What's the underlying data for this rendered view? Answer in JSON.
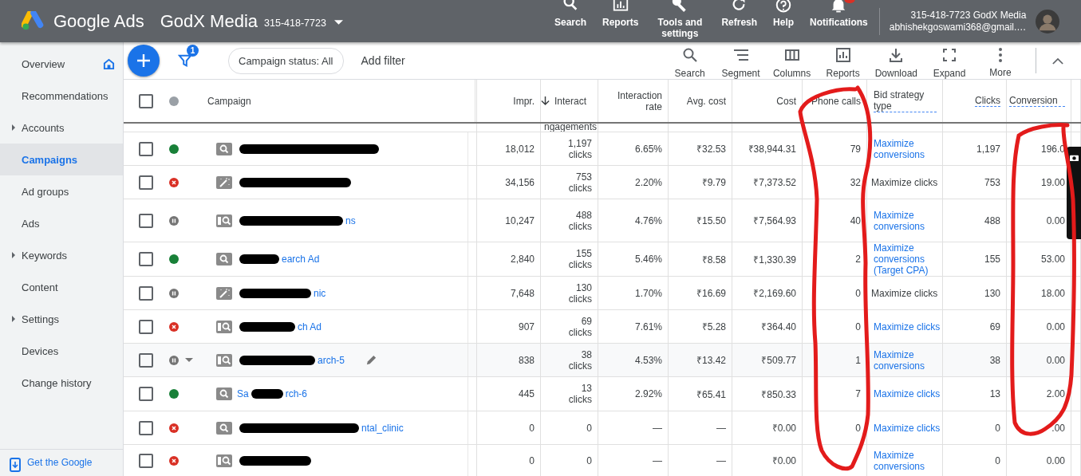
{
  "top_bar": {
    "product": "Google Ads",
    "account_name": "GodX Media",
    "account_id": "315-418-7723",
    "nav": [
      {
        "label": "Search",
        "kind": "search",
        "badge": false
      },
      {
        "label": "Reports",
        "kind": "reports",
        "badge": false
      },
      {
        "label": "Tools and settings",
        "kind": "tools",
        "badge": false
      },
      {
        "label": "Refresh",
        "kind": "refresh",
        "badge": false
      },
      {
        "label": "Help",
        "kind": "help",
        "badge": false
      },
      {
        "label": "Notifications",
        "kind": "notifications",
        "badge": true
      }
    ],
    "user": {
      "account": "315-418-7723 GodX Media",
      "email": "abhishekgoswami368@gmail.…"
    }
  },
  "sidebar": {
    "items": [
      {
        "label": "Overview",
        "kind": "home",
        "selected": false
      },
      {
        "label": "Recommendations",
        "kind": "plain",
        "selected": false
      },
      {
        "label": "Accounts",
        "kind": "expandable",
        "selected": false
      },
      {
        "label": "Campaigns",
        "kind": "plain",
        "selected": true
      },
      {
        "label": "Ad groups",
        "kind": "plain",
        "selected": false
      },
      {
        "label": "Ads",
        "kind": "plain",
        "selected": false
      },
      {
        "label": "Keywords",
        "kind": "expandable",
        "selected": false
      },
      {
        "label": "Content",
        "kind": "plain",
        "selected": false
      },
      {
        "label": "Settings",
        "kind": "expandable",
        "selected": false
      },
      {
        "label": "Devices",
        "kind": "plain",
        "selected": false
      },
      {
        "label": "Change history",
        "kind": "plain",
        "selected": false
      }
    ],
    "footer": "Get the Google"
  },
  "toolbar": {
    "filter_count": "1",
    "filter_chip": "Campaign status: All",
    "add_filter": "Add filter",
    "tools": [
      {
        "label": "Search",
        "kind": "search"
      },
      {
        "label": "Segment",
        "kind": "segment"
      },
      {
        "label": "Columns",
        "kind": "columns"
      },
      {
        "label": "Reports",
        "kind": "reports"
      },
      {
        "label": "Download",
        "kind": "download"
      },
      {
        "label": "Expand",
        "kind": "expand"
      },
      {
        "label": "More",
        "kind": "more"
      }
    ]
  },
  "table": {
    "header_checked": false,
    "columns": [
      {
        "label": "Campaign",
        "sorted": false,
        "underlined": false
      },
      {
        "label": "Impr.",
        "sorted": false,
        "underlined": false
      },
      {
        "label": "Interact",
        "sorted": true,
        "underlined": false
      },
      {
        "label": "Interaction rate",
        "sorted": false,
        "underlined": false
      },
      {
        "label": "Avg. cost",
        "sorted": false,
        "underlined": false
      },
      {
        "label": "Cost",
        "sorted": false,
        "underlined": false
      },
      {
        "label": "Phone calls",
        "sorted": false,
        "underlined": false
      },
      {
        "label": "Bid strategy type",
        "sorted": false,
        "underlined": true
      },
      {
        "label": "Clicks",
        "sorted": false,
        "underlined": true
      },
      {
        "label": "Conversion",
        "sorted": false,
        "underlined": true
      }
    ],
    "subheader": "ngagements",
    "rows": [
      {
        "checked": false,
        "hovered": false,
        "status": {
          "kind": "enabled"
        },
        "campaign_type": {
          "kind": "search"
        },
        "name": [
          {
            "kind": "redaction"
          }
        ],
        "impr": "18,012",
        "interactions": "1,197",
        "unit": "clicks",
        "rate": "6.65%",
        "avg_cost": "₹32.53",
        "cost": "₹38,944.31",
        "phone_calls": "79",
        "bid": {
          "text": "Maximize conversions",
          "link": true
        },
        "clicks": "1,197",
        "conversions": "196.0"
      },
      {
        "checked": false,
        "hovered": false,
        "status": {
          "kind": "removed"
        },
        "campaign_type": {
          "kind": "smart"
        },
        "name": [
          {
            "kind": "redaction"
          }
        ],
        "impr": "34,156",
        "interactions": "753",
        "unit": "clicks",
        "rate": "2.20%",
        "avg_cost": "₹9.79",
        "cost": "₹7,373.52",
        "phone_calls": "32",
        "bid": {
          "text": "Maximize clicks",
          "link": false
        },
        "clicks": "753",
        "conversions": "19.00"
      },
      {
        "checked": false,
        "hovered": false,
        "status": {
          "kind": "paused"
        },
        "campaign_type": {
          "kind": "page-search"
        },
        "name": [
          {
            "kind": "redaction"
          },
          {
            "kind": "text",
            "text": "ns"
          }
        ],
        "impr": "10,247",
        "interactions": "488",
        "unit": "clicks",
        "rate": "4.76%",
        "avg_cost": "₹15.50",
        "cost": "₹7,564.93",
        "phone_calls": "40",
        "bid": {
          "text": "Maximize conversions",
          "link": true
        },
        "clicks": "488",
        "conversions": "0.00"
      },
      {
        "checked": false,
        "hovered": false,
        "status": {
          "kind": "enabled"
        },
        "campaign_type": {
          "kind": "search"
        },
        "name": [
          {
            "kind": "redaction"
          },
          {
            "kind": "text",
            "text": "earch Ad"
          }
        ],
        "impr": "2,840",
        "interactions": "155",
        "unit": "clicks",
        "rate": "5.46%",
        "avg_cost": "₹8.58",
        "cost": "₹1,330.39",
        "phone_calls": "2",
        "bid": {
          "text": "Maximize conversions (Target CPA)",
          "link": true
        },
        "clicks": "155",
        "conversions": "53.00"
      },
      {
        "checked": false,
        "hovered": false,
        "status": {
          "kind": "paused"
        },
        "campaign_type": {
          "kind": "smart"
        },
        "name": [
          {
            "kind": "redaction"
          },
          {
            "kind": "text",
            "text": "nic"
          }
        ],
        "impr": "7,648",
        "interactions": "130",
        "unit": "clicks",
        "rate": "1.70%",
        "avg_cost": "₹16.69",
        "cost": "₹2,169.60",
        "phone_calls": "0",
        "bid": {
          "text": "Maximize clicks",
          "link": false
        },
        "clicks": "130",
        "conversions": "18.00"
      },
      {
        "checked": false,
        "hovered": false,
        "status": {
          "kind": "removed"
        },
        "campaign_type": {
          "kind": "page-search"
        },
        "name": [
          {
            "kind": "redaction"
          },
          {
            "kind": "text",
            "text": "ch Ad"
          }
        ],
        "impr": "907",
        "interactions": "69",
        "unit": "clicks",
        "rate": "7.61%",
        "avg_cost": "₹5.28",
        "cost": "₹364.40",
        "phone_calls": "0",
        "bid": {
          "text": "Maximize clicks",
          "link": true
        },
        "clicks": "69",
        "conversions": "0.00"
      },
      {
        "checked": false,
        "hovered": true,
        "status": {
          "kind": "paused"
        },
        "campaign_type": {
          "kind": "page-search"
        },
        "name": [
          {
            "kind": "redaction"
          },
          {
            "kind": "text",
            "text": "arch-5"
          }
        ],
        "impr": "838",
        "interactions": "38",
        "unit": "clicks",
        "rate": "4.53%",
        "avg_cost": "₹13.42",
        "cost": "₹509.77",
        "phone_calls": "1",
        "bid": {
          "text": "Maximize conversions",
          "link": true
        },
        "clicks": "38",
        "conversions": "0.00"
      },
      {
        "checked": false,
        "hovered": false,
        "status": {
          "kind": "enabled"
        },
        "campaign_type": {
          "kind": "search"
        },
        "name": [
          {
            "kind": "text",
            "text": "Sa"
          },
          {
            "kind": "redaction"
          },
          {
            "kind": "text",
            "text": "rch-6"
          }
        ],
        "impr": "445",
        "interactions": "13",
        "unit": "clicks",
        "rate": "2.92%",
        "avg_cost": "₹65.41",
        "cost": "₹850.33",
        "phone_calls": "7",
        "bid": {
          "text": "Maximize clicks",
          "link": true
        },
        "clicks": "13",
        "conversions": "2.00"
      },
      {
        "checked": false,
        "hovered": false,
        "status": {
          "kind": "removed"
        },
        "campaign_type": {
          "kind": "search"
        },
        "name": [
          {
            "kind": "redaction"
          },
          {
            "kind": "text",
            "text": "ntal_clinic"
          }
        ],
        "impr": "0",
        "interactions": "0",
        "rate": "—",
        "avg_cost": "—",
        "cost": "₹0.00",
        "phone_calls": "0",
        "bid": {
          "text": "Maximize clicks",
          "link": true
        },
        "clicks": "0",
        "conversions": ".00"
      },
      {
        "checked": false,
        "hovered": false,
        "status": {
          "kind": "removed"
        },
        "campaign_type": {
          "kind": "page-search"
        },
        "name": [
          {
            "kind": "redaction"
          }
        ],
        "impr": "0",
        "interactions": "0",
        "rate": "—",
        "avg_cost": "—",
        "cost": "₹0.00",
        "bid": {
          "text": "Maximize conversions",
          "link": true
        },
        "clicks": "0",
        "conversions": "0.00"
      }
    ]
  }
}
